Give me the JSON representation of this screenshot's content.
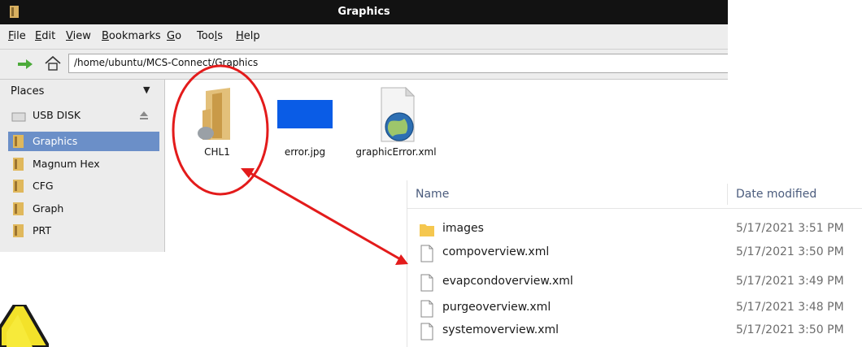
{
  "window": {
    "title": "Graphics"
  },
  "menu": [
    {
      "pre": "",
      "key": "F",
      "post": "ile"
    },
    {
      "pre": "",
      "key": "E",
      "post": "dit"
    },
    {
      "pre": "",
      "key": "V",
      "post": "iew"
    },
    {
      "pre": "",
      "key": "B",
      "post": "ookmarks"
    },
    {
      "pre": "",
      "key": "G",
      "post": "o"
    },
    {
      "pre": "Too",
      "key": "l",
      "post": "s"
    },
    {
      "pre": "",
      "key": "H",
      "post": "elp"
    }
  ],
  "location": {
    "path": "/home/ubuntu/MCS-Connect/Graphics"
  },
  "sidebar": {
    "header": "Places",
    "items": [
      {
        "label": "USB DISK",
        "icon": "usb-disk-icon"
      },
      {
        "label": "Graphics",
        "icon": "folder-icon",
        "selected": true
      },
      {
        "label": "Magnum Hex",
        "icon": "folder-icon"
      },
      {
        "label": "CFG",
        "icon": "folder-icon"
      },
      {
        "label": "Graph",
        "icon": "folder-icon"
      },
      {
        "label": "PRT",
        "icon": "folder-icon"
      }
    ]
  },
  "files": [
    {
      "name": "CHL1",
      "icon": "folder-icon"
    },
    {
      "name": "error.jpg",
      "icon": "image-icon"
    },
    {
      "name": "graphicError.xml",
      "icon": "xml-globe-icon"
    }
  ],
  "explorer": {
    "columns": {
      "name": "Name",
      "date": "Date modified"
    },
    "rows": [
      {
        "name": "images",
        "date": "5/17/2021 3:51 PM",
        "icon": "folder-icon"
      },
      {
        "name": "compoverview.xml",
        "date": "5/17/2021 3:50 PM",
        "icon": "file-icon"
      },
      {
        "name": "evapcondoverview.xml",
        "date": "5/17/2021 3:49 PM",
        "icon": "file-icon"
      },
      {
        "name": "purgeoverview.xml",
        "date": "5/17/2021 3:48 PM",
        "icon": "file-icon"
      },
      {
        "name": "systemoverview.xml",
        "date": "5/17/2021 3:50 PM",
        "icon": "file-icon"
      }
    ]
  },
  "colors": {
    "annotation": "#e31b1b",
    "selection": "#6b8fc8",
    "titlebar": "#121212",
    "error_jpg_thumb": "#0a5ce6"
  }
}
